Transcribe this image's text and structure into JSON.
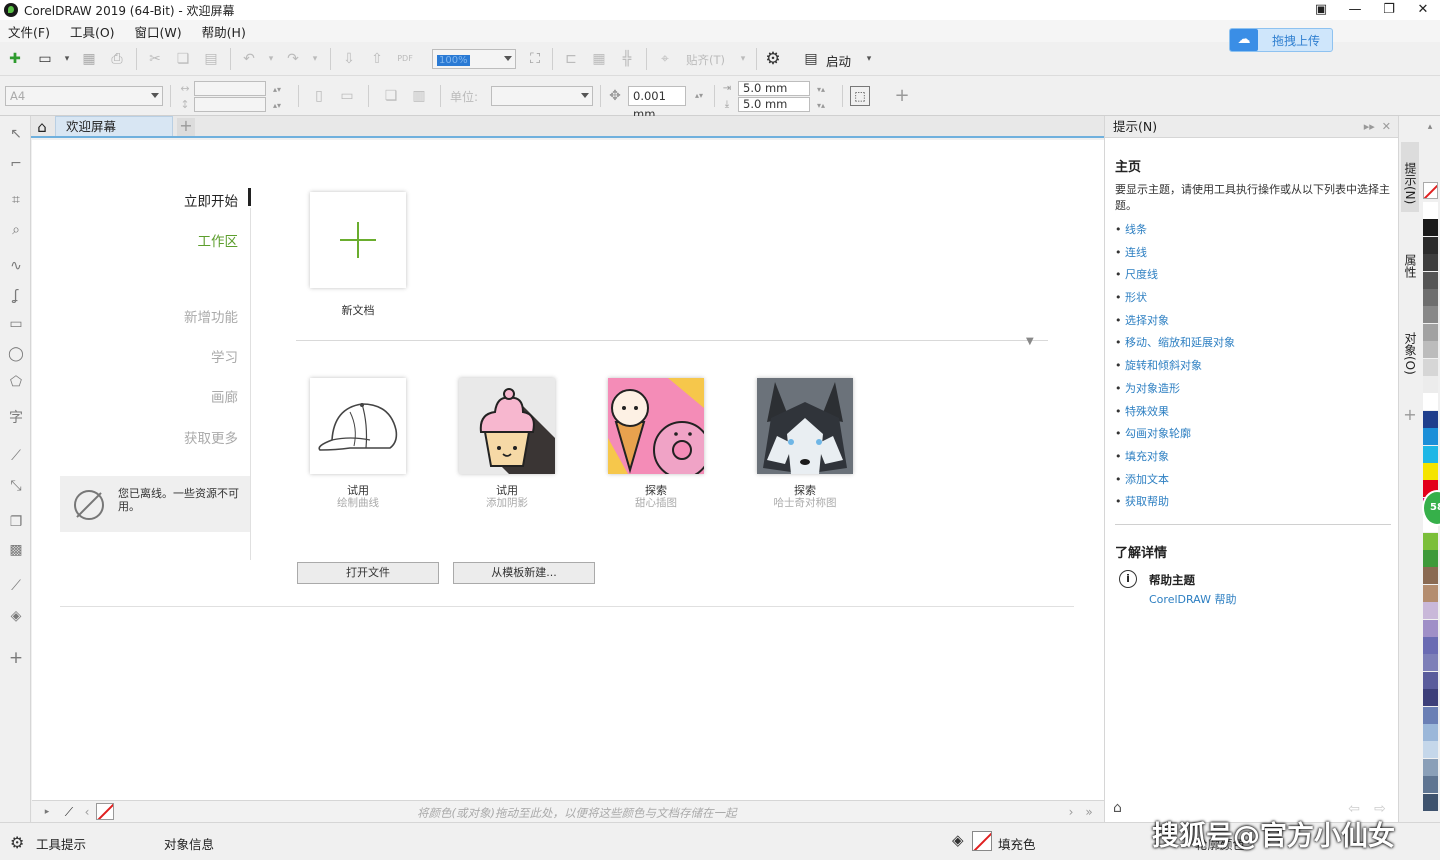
{
  "window": {
    "title": "CorelDRAW 2019 (64-Bit) - 欢迎屏幕",
    "controls": [
      "minimize",
      "restore",
      "close"
    ]
  },
  "menu": [
    "文件(F)",
    "工具(O)",
    "窗口(W)",
    "帮助(H)"
  ],
  "toolbar": {
    "zoom_value": "100%",
    "snap_label": "贴齐(T)",
    "launch_label": "启动",
    "upload_label": "拖拽上传"
  },
  "propertybar": {
    "page_size": "A4",
    "units_label": "单位:",
    "nudge": "0.001 mm",
    "dup_x": "5.0 mm",
    "dup_y": "5.0 mm"
  },
  "tabs": {
    "welcome": "欢迎屏幕"
  },
  "nav": {
    "items": [
      "立即开始",
      "工作区",
      "新增功能",
      "学习",
      "画廊",
      "获取更多"
    ],
    "offline_msg": "您已离线。一些资源不可用。"
  },
  "welcome": {
    "new_doc": "新文档",
    "cards": [
      {
        "title": "试用",
        "subtitle": "绘制曲线"
      },
      {
        "title": "试用",
        "subtitle": "添加阴影"
      },
      {
        "title": "探索",
        "subtitle": "甜心插图"
      },
      {
        "title": "探索",
        "subtitle": "哈士奇对称图"
      }
    ],
    "open_file": "打开文件",
    "from_template": "从模板新建..."
  },
  "docbar": {
    "hint": "将颜色(或对象)拖动至此处，以便将这些颜色与文档存储在一起"
  },
  "status": {
    "tool_hint": "工具提示",
    "object_info": "对象信息",
    "fill_label": "填充色",
    "outline_label": "轮廓颜色"
  },
  "docker": {
    "title": "提示(N)",
    "heading": "主页",
    "description": "要显示主题，请使用工具执行操作或从以下列表中选择主题。",
    "topics": [
      "线条",
      "连线",
      "尺度线",
      "形状",
      "选择对象",
      "移动、缩放和延展对象",
      "旋转和倾斜对象",
      "为对象造形",
      "特殊效果",
      "勾画对象轮廓",
      "填充对象",
      "添加文本",
      "获取帮助"
    ],
    "learn_more": "了解详情",
    "help_topics": "帮助主题",
    "help_link": "CorelDRAW 帮助"
  },
  "vtabs": [
    "提示(N)",
    "属性",
    "对象(O)"
  ],
  "palette_colors": [
    "#ffffff",
    "#1a1a1a",
    "#2b2b2b",
    "#3d3d3d",
    "#555555",
    "#6e6e6e",
    "#888888",
    "#a2a2a2",
    "#bcbcbc",
    "#d6d6d6",
    "#ececec",
    "#ffffff",
    "#1f3e8c",
    "#1c8fd8",
    "#1fb7e6",
    "#f5e400",
    "#e3001b",
    "#e6007e",
    "#ffffff",
    "#7bbf3a",
    "#3f9a3a",
    "#8a6a52",
    "#b48d6f",
    "#c9b8d9",
    "#9f8fc7",
    "#6a6bb3",
    "#7d7fb8",
    "#5a5c9c",
    "#3d3f7a",
    "#6a7fb5",
    "#9bb7d9",
    "#c5d7ea",
    "#8a9fb8",
    "#5f7592",
    "#3f536e"
  ],
  "watermark": "搜狐号@官方小仙女"
}
